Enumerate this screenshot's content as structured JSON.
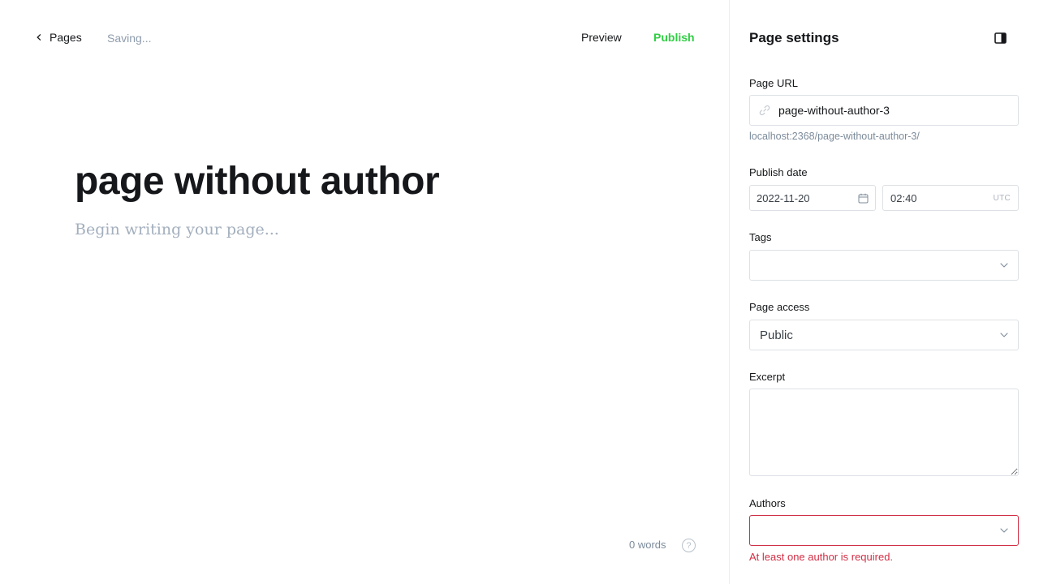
{
  "topbar": {
    "back_label": "Pages",
    "save_status": "Saving...",
    "preview_label": "Preview",
    "publish_label": "Publish"
  },
  "editor": {
    "title": "page without author",
    "body_placeholder": "Begin writing your page...",
    "word_count": "0 words",
    "help_symbol": "?"
  },
  "sidebar": {
    "title": "Page settings",
    "page_url": {
      "label": "Page URL",
      "value": "page-without-author-3",
      "hint": "localhost:2368/page-without-author-3/"
    },
    "publish_date": {
      "label": "Publish date",
      "date": "2022-11-20",
      "time": "02:40",
      "timezone": "UTC"
    },
    "tags": {
      "label": "Tags",
      "value": ""
    },
    "page_access": {
      "label": "Page access",
      "value": "Public"
    },
    "excerpt": {
      "label": "Excerpt",
      "value": ""
    },
    "authors": {
      "label": "Authors",
      "value": "",
      "error": "At least one author is required."
    }
  },
  "colors": {
    "accent_publish": "#30cf43",
    "error": "#d12f45",
    "muted_text": "#8e9cac",
    "border": "#dde1e5"
  },
  "icons": {
    "back": "chevron-left-icon",
    "help": "question-circle-icon",
    "panel": "sidebar-toggle-icon",
    "link": "link-icon",
    "calendar": "calendar-icon",
    "dropdown": "chevron-down-icon"
  }
}
